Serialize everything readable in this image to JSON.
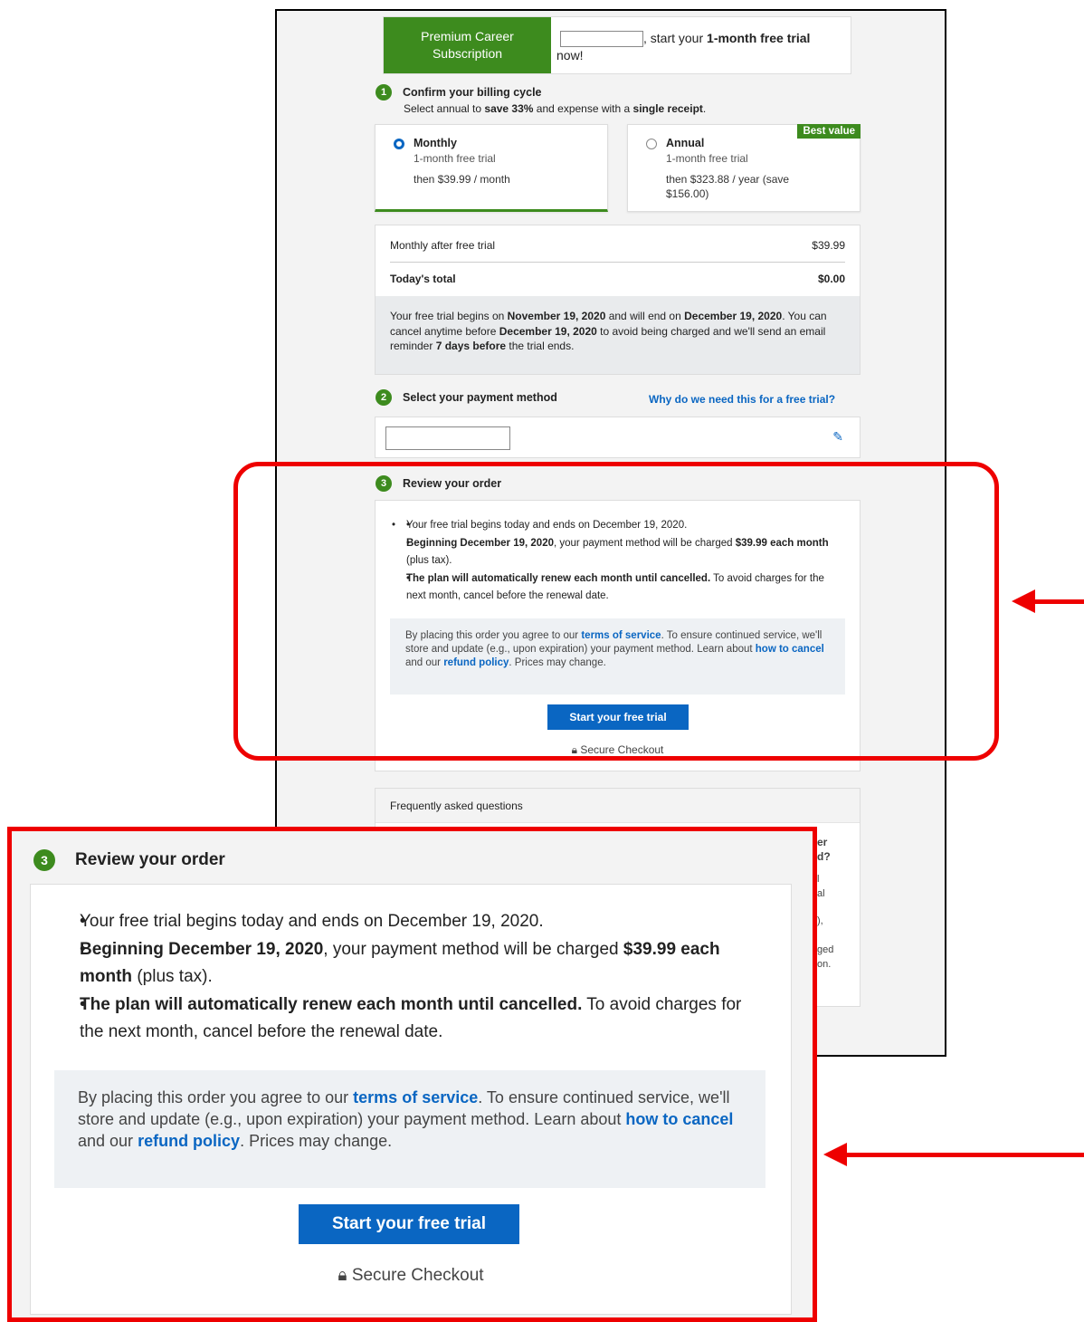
{
  "header": {
    "brand": "Premium Career Subscription",
    "greeting_suffix": ", start your ",
    "greeting_bold": "1-month free trial",
    "greeting_end": " now!"
  },
  "step1": {
    "number": "1",
    "title": "Confirm your billing cycle",
    "subtitle_pre": "Select annual to ",
    "subtitle_bold1": "save 33%",
    "subtitle_mid": " and expense with a ",
    "subtitle_bold2": "single receipt",
    "subtitle_end": "."
  },
  "plans": [
    {
      "name": "Monthly",
      "trial": "1-month free trial",
      "price": "then $39.99 / month",
      "selected": true
    },
    {
      "name": "Annual",
      "trial": "1-month free trial",
      "price": "then $323.88 / year (save $156.00)",
      "selected": false,
      "badge": "Best value"
    }
  ],
  "summary": {
    "row1_label": "Monthly after free trial",
    "row1_value": "$39.99",
    "total_label": "Today's total",
    "total_value": "$0.00",
    "note_1": "Your free trial begins on ",
    "note_b1": "November 19, 2020",
    "note_2": " and will end on ",
    "note_b2": "December 19, 2020",
    "note_3": ". You can cancel anytime before ",
    "note_b3": "December 19, 2020",
    "note_4": " to avoid being charged and we'll send an email reminder ",
    "note_b4": "7 days before",
    "note_5": " the trial ends."
  },
  "step2": {
    "number": "2",
    "title": "Select your payment method",
    "help_link": "Why do we need this for a free trial?"
  },
  "step3": {
    "number": "3",
    "title": "Review your order",
    "bullet1": "Your free trial begins today and ends on December 19, 2020.",
    "bullet2_b1": "Beginning December 19, 2020",
    "bullet2_mid": ", your payment method will be charged ",
    "bullet2_b2": "$39.99 each month",
    "bullet2_end": " (plus tax).",
    "bullet3_b": "The plan will automatically renew each month until cancelled.",
    "bullet3_end": " To avoid charges for the next month, cancel before the renewal date.",
    "terms_1": "By placing this order you agree to our ",
    "terms_link1": "terms of service",
    "terms_2": ". To ensure continued service, we'll store and update (e.g., upon expiration) your payment method. Learn about ",
    "terms_link2": "how to cancel",
    "terms_3": " and our ",
    "terms_link3": "refund policy",
    "terms_4": ". Prices may change.",
    "cta": "Start your free trial",
    "secure": "Secure Checkout"
  },
  "faq": {
    "title": "Frequently asked questions",
    "frag1": "er",
    "frag2": "d?",
    "frag3": "l",
    "frag4": "al",
    "frag5": "),",
    "frag6": "ged",
    "frag7": "on."
  },
  "colors": {
    "brand_green": "#3d8b1e",
    "link_blue": "#0a66c2",
    "highlight_red": "#e00000"
  }
}
